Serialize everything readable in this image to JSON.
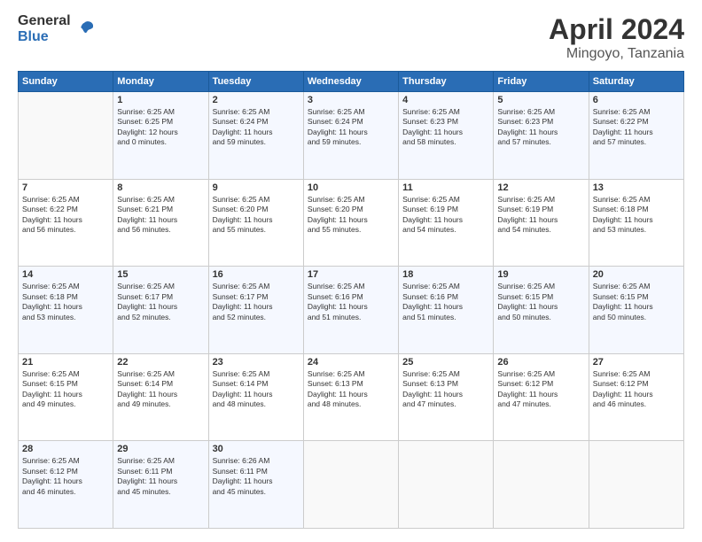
{
  "header": {
    "logo_general": "General",
    "logo_blue": "Blue",
    "month": "April 2024",
    "location": "Mingoyo, Tanzania"
  },
  "days_of_week": [
    "Sunday",
    "Monday",
    "Tuesday",
    "Wednesday",
    "Thursday",
    "Friday",
    "Saturday"
  ],
  "weeks": [
    [
      {
        "day": "",
        "info": ""
      },
      {
        "day": "1",
        "info": "Sunrise: 6:25 AM\nSunset: 6:25 PM\nDaylight: 12 hours\nand 0 minutes."
      },
      {
        "day": "2",
        "info": "Sunrise: 6:25 AM\nSunset: 6:24 PM\nDaylight: 11 hours\nand 59 minutes."
      },
      {
        "day": "3",
        "info": "Sunrise: 6:25 AM\nSunset: 6:24 PM\nDaylight: 11 hours\nand 59 minutes."
      },
      {
        "day": "4",
        "info": "Sunrise: 6:25 AM\nSunset: 6:23 PM\nDaylight: 11 hours\nand 58 minutes."
      },
      {
        "day": "5",
        "info": "Sunrise: 6:25 AM\nSunset: 6:23 PM\nDaylight: 11 hours\nand 57 minutes."
      },
      {
        "day": "6",
        "info": "Sunrise: 6:25 AM\nSunset: 6:22 PM\nDaylight: 11 hours\nand 57 minutes."
      }
    ],
    [
      {
        "day": "7",
        "info": "Sunrise: 6:25 AM\nSunset: 6:22 PM\nDaylight: 11 hours\nand 56 minutes."
      },
      {
        "day": "8",
        "info": "Sunrise: 6:25 AM\nSunset: 6:21 PM\nDaylight: 11 hours\nand 56 minutes."
      },
      {
        "day": "9",
        "info": "Sunrise: 6:25 AM\nSunset: 6:20 PM\nDaylight: 11 hours\nand 55 minutes."
      },
      {
        "day": "10",
        "info": "Sunrise: 6:25 AM\nSunset: 6:20 PM\nDaylight: 11 hours\nand 55 minutes."
      },
      {
        "day": "11",
        "info": "Sunrise: 6:25 AM\nSunset: 6:19 PM\nDaylight: 11 hours\nand 54 minutes."
      },
      {
        "day": "12",
        "info": "Sunrise: 6:25 AM\nSunset: 6:19 PM\nDaylight: 11 hours\nand 54 minutes."
      },
      {
        "day": "13",
        "info": "Sunrise: 6:25 AM\nSunset: 6:18 PM\nDaylight: 11 hours\nand 53 minutes."
      }
    ],
    [
      {
        "day": "14",
        "info": "Sunrise: 6:25 AM\nSunset: 6:18 PM\nDaylight: 11 hours\nand 53 minutes."
      },
      {
        "day": "15",
        "info": "Sunrise: 6:25 AM\nSunset: 6:17 PM\nDaylight: 11 hours\nand 52 minutes."
      },
      {
        "day": "16",
        "info": "Sunrise: 6:25 AM\nSunset: 6:17 PM\nDaylight: 11 hours\nand 52 minutes."
      },
      {
        "day": "17",
        "info": "Sunrise: 6:25 AM\nSunset: 6:16 PM\nDaylight: 11 hours\nand 51 minutes."
      },
      {
        "day": "18",
        "info": "Sunrise: 6:25 AM\nSunset: 6:16 PM\nDaylight: 11 hours\nand 51 minutes."
      },
      {
        "day": "19",
        "info": "Sunrise: 6:25 AM\nSunset: 6:15 PM\nDaylight: 11 hours\nand 50 minutes."
      },
      {
        "day": "20",
        "info": "Sunrise: 6:25 AM\nSunset: 6:15 PM\nDaylight: 11 hours\nand 50 minutes."
      }
    ],
    [
      {
        "day": "21",
        "info": "Sunrise: 6:25 AM\nSunset: 6:15 PM\nDaylight: 11 hours\nand 49 minutes."
      },
      {
        "day": "22",
        "info": "Sunrise: 6:25 AM\nSunset: 6:14 PM\nDaylight: 11 hours\nand 49 minutes."
      },
      {
        "day": "23",
        "info": "Sunrise: 6:25 AM\nSunset: 6:14 PM\nDaylight: 11 hours\nand 48 minutes."
      },
      {
        "day": "24",
        "info": "Sunrise: 6:25 AM\nSunset: 6:13 PM\nDaylight: 11 hours\nand 48 minutes."
      },
      {
        "day": "25",
        "info": "Sunrise: 6:25 AM\nSunset: 6:13 PM\nDaylight: 11 hours\nand 47 minutes."
      },
      {
        "day": "26",
        "info": "Sunrise: 6:25 AM\nSunset: 6:12 PM\nDaylight: 11 hours\nand 47 minutes."
      },
      {
        "day": "27",
        "info": "Sunrise: 6:25 AM\nSunset: 6:12 PM\nDaylight: 11 hours\nand 46 minutes."
      }
    ],
    [
      {
        "day": "28",
        "info": "Sunrise: 6:25 AM\nSunset: 6:12 PM\nDaylight: 11 hours\nand 46 minutes."
      },
      {
        "day": "29",
        "info": "Sunrise: 6:25 AM\nSunset: 6:11 PM\nDaylight: 11 hours\nand 45 minutes."
      },
      {
        "day": "30",
        "info": "Sunrise: 6:26 AM\nSunset: 6:11 PM\nDaylight: 11 hours\nand 45 minutes."
      },
      {
        "day": "",
        "info": ""
      },
      {
        "day": "",
        "info": ""
      },
      {
        "day": "",
        "info": ""
      },
      {
        "day": "",
        "info": ""
      }
    ]
  ]
}
